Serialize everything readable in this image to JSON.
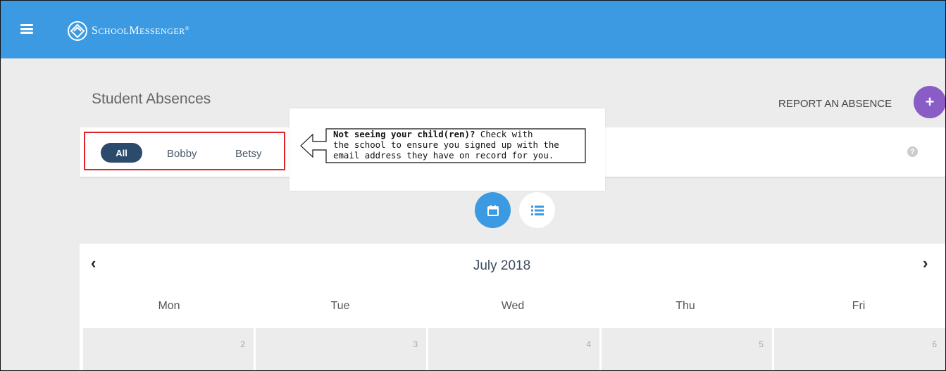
{
  "app": {
    "name_first": "S",
    "name_rest1": "CHOOL",
    "name_mid": "M",
    "name_rest2": "ESSENGER",
    "reg": "®"
  },
  "page": {
    "title": "Student Absences",
    "report_label": "REPORT AN ABSENCE",
    "report_icon": "+"
  },
  "filters": {
    "all": "All",
    "children": [
      "Bobby",
      "Betsy"
    ],
    "help": "?"
  },
  "callout": {
    "bold": "Not seeing your child(ren)?",
    "line1_rest": " Check with",
    "line2": "the school to ensure you signed up with the",
    "line3": "email address they have on record for you."
  },
  "calendar": {
    "month": "July 2018",
    "prev": "‹",
    "next": "›",
    "weekdays": [
      "Mon",
      "Tue",
      "Wed",
      "Thu",
      "Fri"
    ],
    "days": [
      "2",
      "3",
      "4",
      "5",
      "6"
    ]
  },
  "colors": {
    "topbar": "#3b9ae1",
    "accent_purple": "#8a5cc6",
    "chip_all": "#2c4b6c",
    "highlight_border": "#e0242a"
  },
  "icons": {
    "menu": "hamburger-icon",
    "calendar_view": "calendar-icon",
    "list_view": "list-icon",
    "help": "question-icon",
    "logo": "logo-mark-icon"
  }
}
